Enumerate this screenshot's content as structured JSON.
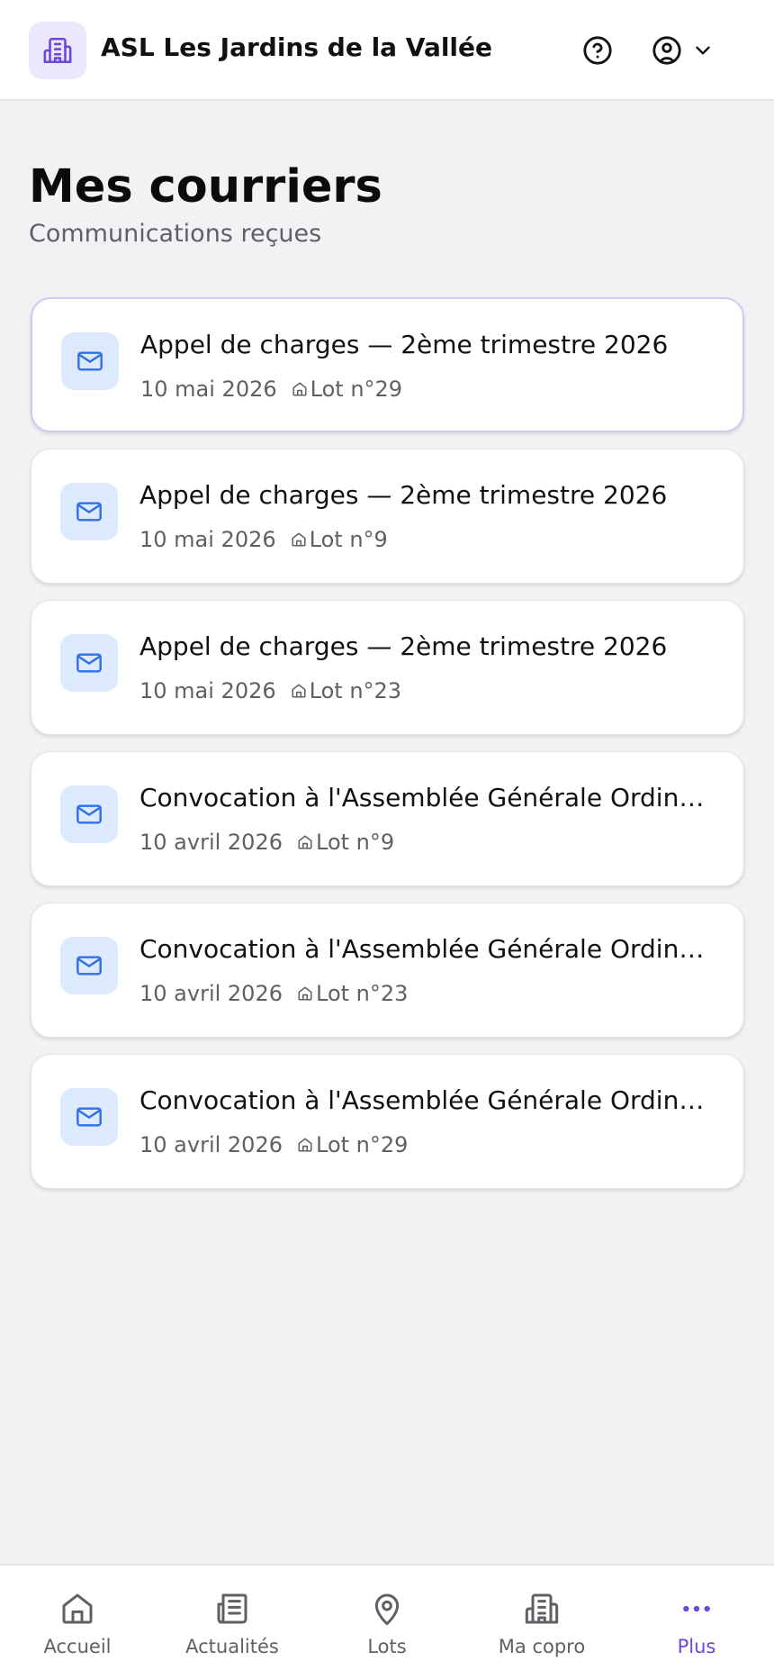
{
  "header": {
    "title": "ASL Les Jardins de la Vallée",
    "logo_icon": "building-icon",
    "help_icon": "help-circle-icon",
    "account_icon": "user-circle-icon",
    "account_chevron_icon": "chevron-down-icon"
  },
  "page": {
    "title": "Mes courriers",
    "subtitle": "Communications reçues"
  },
  "letters": [
    {
      "title": "Appel de charges — 2ème trimestre 2026",
      "date": "10 mai 2026",
      "lot": "Lot n°29",
      "selected": true
    },
    {
      "title": "Appel de charges — 2ème trimestre 2026",
      "date": "10 mai 2026",
      "lot": "Lot n°9"
    },
    {
      "title": "Appel de charges — 2ème trimestre 2026",
      "date": "10 mai 2026",
      "lot": "Lot n°23"
    },
    {
      "title": "Convocation à l'Assemblée Générale Ordinaire",
      "date": "10 avril 2026",
      "lot": "Lot n°9"
    },
    {
      "title": "Convocation à l'Assemblée Générale Ordinaire",
      "date": "10 avril 2026",
      "lot": "Lot n°23"
    },
    {
      "title": "Convocation à l'Assemblée Générale Ordinaire",
      "date": "10 avril 2026",
      "lot": "Lot n°29"
    }
  ],
  "nav": {
    "items": [
      {
        "label": "Accueil",
        "icon": "home-icon"
      },
      {
        "label": "Actualités",
        "icon": "newspaper-icon"
      },
      {
        "label": "Lots",
        "icon": "map-pin-icon"
      },
      {
        "label": "Ma copro",
        "icon": "building-icon"
      },
      {
        "label": "Plus",
        "icon": "more-dots-icon",
        "active": true
      }
    ]
  },
  "colors": {
    "accent": "#6b46e0",
    "mail_icon": "#2f6fe8",
    "mail_icon_bg": "#dde9fd",
    "logo_bg": "#ece8fc",
    "background": "#f2f2f5"
  }
}
